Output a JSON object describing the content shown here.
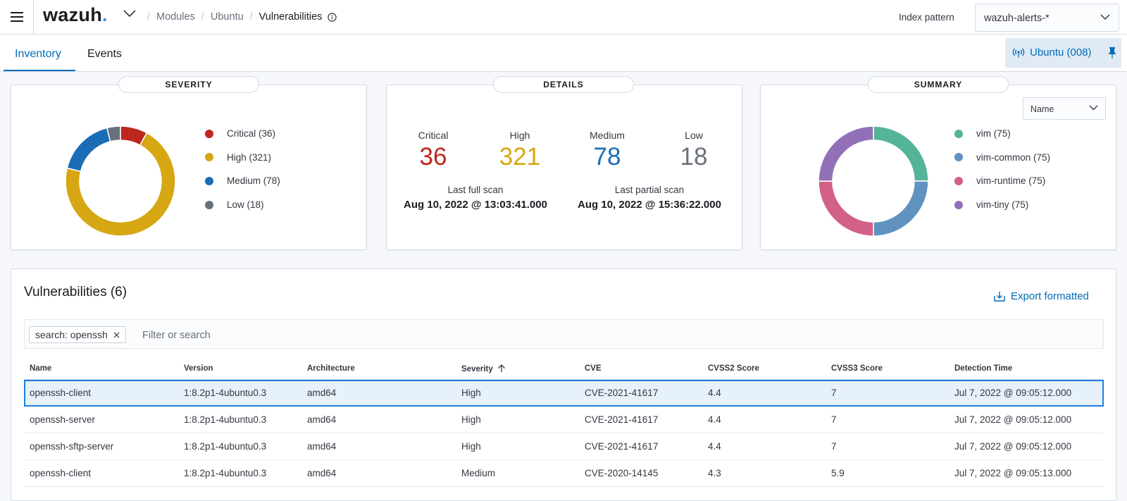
{
  "header": {
    "logo_text": "wazuh",
    "logo_dot": ".",
    "breadcrumbs": [
      "Modules",
      "Ubuntu",
      "Vulnerabilities"
    ],
    "index_pattern_label": "Index pattern",
    "index_pattern_value": "wazuh-alerts-*"
  },
  "tabs": [
    {
      "label": "Inventory",
      "active": true
    },
    {
      "label": "Events",
      "active": false
    }
  ],
  "agent": {
    "label": "Ubuntu (008)"
  },
  "severity_panel": {
    "title": "SEVERITY",
    "chart_data": {
      "type": "pie",
      "donut": true,
      "categories": [
        "Critical",
        "High",
        "Medium",
        "Low"
      ],
      "values": [
        36,
        321,
        78,
        18
      ],
      "colors": [
        "#bd271e",
        "#d6a712",
        "#1a6db5",
        "#69707d"
      ],
      "legend_labels": [
        "Critical (36)",
        "High (321)",
        "Medium (78)",
        "Low (18)"
      ],
      "legend": "right"
    }
  },
  "details_panel": {
    "title": "DETAILS",
    "counts": [
      {
        "label": "Critical",
        "value": "36",
        "color": "#bd271e"
      },
      {
        "label": "High",
        "value": "321",
        "color": "#d6a712"
      },
      {
        "label": "Medium",
        "value": "78",
        "color": "#1a6db5"
      },
      {
        "label": "Low",
        "value": "18",
        "color": "#69707d"
      }
    ],
    "last_full_scan_label": "Last full scan",
    "last_full_scan_value": "Aug 10, 2022 @ 13:03:41.000",
    "last_partial_scan_label": "Last partial scan",
    "last_partial_scan_value": "Aug 10, 2022 @ 15:36:22.000"
  },
  "summary_panel": {
    "title": "SUMMARY",
    "field_select": "Name",
    "chart_data": {
      "type": "pie",
      "donut": true,
      "categories": [
        "vim",
        "vim-common",
        "vim-runtime",
        "vim-tiny"
      ],
      "values": [
        75,
        75,
        75,
        75
      ],
      "colors": [
        "#54b399",
        "#6092c0",
        "#d36086",
        "#9170b8"
      ],
      "legend_labels": [
        "vim (75)",
        "vim-common (75)",
        "vim-runtime (75)",
        "vim-tiny (75)"
      ],
      "legend": "right"
    }
  },
  "vulnerabilities": {
    "title": "Vulnerabilities (6)",
    "export_label": "Export formatted",
    "filter_pill": "search: openssh",
    "filter_placeholder": "Filter or search",
    "columns": [
      "Name",
      "Version",
      "Architecture",
      "Severity",
      "CVE",
      "CVSS2 Score",
      "CVSS3 Score",
      "Detection Time"
    ],
    "rows": [
      [
        "openssh-client",
        "1:8.2p1-4ubuntu0.3",
        "amd64",
        "High",
        "CVE-2021-41617",
        "4.4",
        "7",
        "Jul 7, 2022 @ 09:05:12.000"
      ],
      [
        "openssh-server",
        "1:8.2p1-4ubuntu0.3",
        "amd64",
        "High",
        "CVE-2021-41617",
        "4.4",
        "7",
        "Jul 7, 2022 @ 09:05:12.000"
      ],
      [
        "openssh-sftp-server",
        "1:8.2p1-4ubuntu0.3",
        "amd64",
        "High",
        "CVE-2021-41617",
        "4.4",
        "7",
        "Jul 7, 2022 @ 09:05:12.000"
      ],
      [
        "openssh-client",
        "1:8.2p1-4ubuntu0.3",
        "amd64",
        "Medium",
        "CVE-2020-14145",
        "4.3",
        "5.9",
        "Jul 7, 2022 @ 09:05:13.000"
      ]
    ]
  }
}
